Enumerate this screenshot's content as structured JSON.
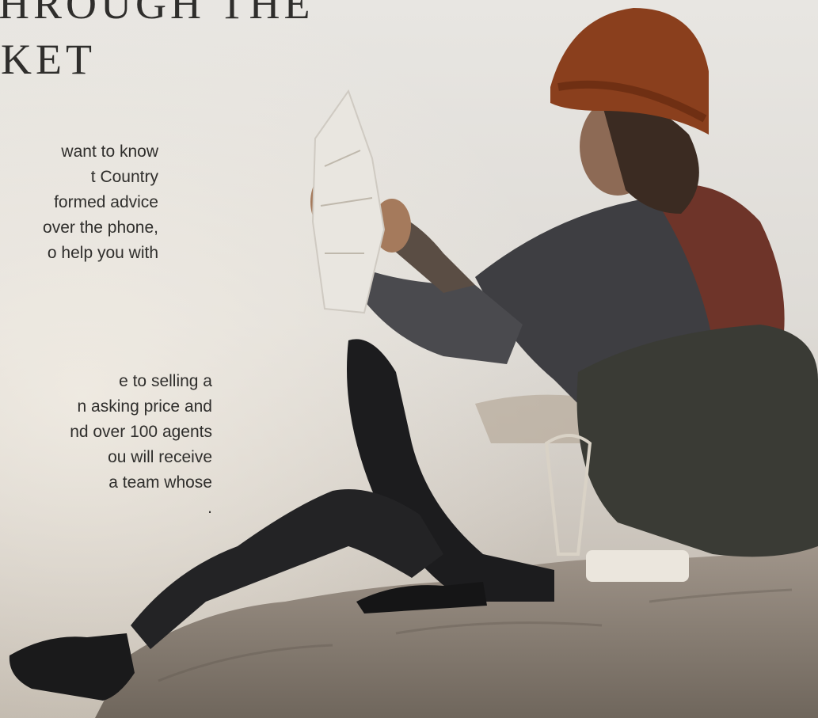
{
  "heading": {
    "lines": [
      "THROUGH THE",
      "RKET"
    ]
  },
  "paragraphs": [
    {
      "lines": [
        "want to know",
        "t Country",
        "formed advice",
        "over the phone,",
        "o help you with"
      ]
    },
    {
      "lines": [
        "e to selling a",
        "n asking price and",
        "nd over 100 agents",
        "ou will receive",
        "a team whose",
        "."
      ]
    }
  ],
  "image": {
    "subject": "hiker-reading-map-on-rock"
  },
  "colors": {
    "text": "#2f2e2c",
    "sky": "#e4e1dc",
    "hat": "#8a3f1d",
    "rock": "#8f8479"
  }
}
